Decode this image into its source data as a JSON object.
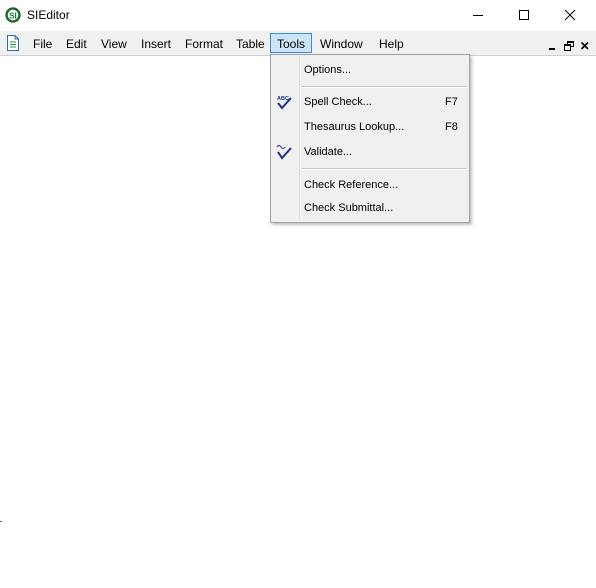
{
  "window": {
    "title": "SIEditor",
    "app_icon": "si-logo-icon",
    "controls": [
      "minimize-icon",
      "maximize-icon",
      "close-icon"
    ]
  },
  "menubar": {
    "doc_icon": "document-icon",
    "items": [
      {
        "label": "File"
      },
      {
        "label": "Edit"
      },
      {
        "label": "View"
      },
      {
        "label": "Insert"
      },
      {
        "label": "Format"
      },
      {
        "label": "Table"
      },
      {
        "label": "Tools",
        "active": true
      },
      {
        "label": "Window"
      },
      {
        "label": "Help"
      }
    ],
    "mdi_controls": [
      "mdi-minimize-icon",
      "mdi-restore-icon",
      "mdi-close-icon"
    ]
  },
  "tools_menu": {
    "items": [
      {
        "label": "Options...",
        "shortcut": "",
        "icon": ""
      },
      {
        "label": "Spell Check...",
        "shortcut": "F7",
        "icon": "spell-check-icon"
      },
      {
        "label": "Thesaurus Lookup...",
        "shortcut": "F8",
        "icon": ""
      },
      {
        "label": "Validate...",
        "shortcut": "",
        "icon": "validate-icon"
      },
      {
        "label": "Check Reference...",
        "shortcut": "",
        "icon": ""
      },
      {
        "label": "Check Submittal...",
        "shortcut": "",
        "icon": ""
      }
    ]
  },
  "colors": {
    "menu_highlight": "#cce4f7",
    "menu_highlight_border": "#3e8ad4",
    "menu_background": "#f0f0f0",
    "app_icon_green": "#1e7b34",
    "check_blue": "#1c2d8f"
  }
}
